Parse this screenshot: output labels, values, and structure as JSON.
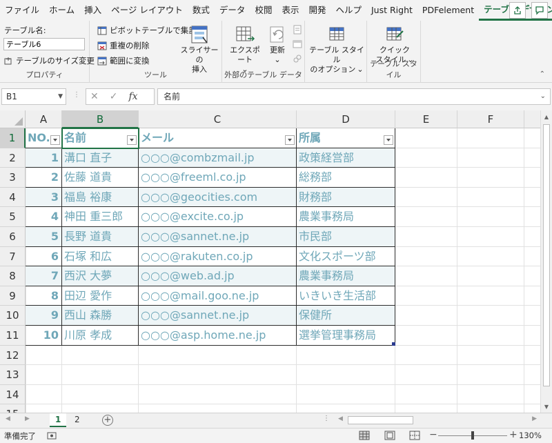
{
  "ribbon_tabs": [
    "ファイル",
    "ホーム",
    "挿入",
    "ページ レイアウト",
    "数式",
    "データ",
    "校閲",
    "表示",
    "開発",
    "ヘルプ",
    "Just Right",
    "PDFelement",
    "テーブル デザイン"
  ],
  "ribbon": {
    "properties": {
      "table_name_label": "テーブル名:",
      "table_name_value": "テーブル6",
      "resize_label": "テーブルのサイズ変更",
      "group_label": "プロパティ"
    },
    "tools": {
      "pivot_label": "ピボットテーブルで集計",
      "remove_dup_label": "重複の削除",
      "convert_label": "範囲に変換",
      "slicer_label_1": "スライサーの",
      "slicer_label_2": "挿入",
      "group_label": "ツール"
    },
    "external": {
      "export_label": "エクスポート",
      "refresh_label": "更新",
      "group_label": "外部のテーブル データ"
    },
    "style_options": {
      "label_1": "テーブル スタイル",
      "label_2": "のオプション",
      "caret": "⌄"
    },
    "styles": {
      "quick_label_1": "クイック",
      "quick_label_2": "スタイル",
      "caret": "⌄",
      "group_label": "テーブル スタイル"
    },
    "caret": "⌄"
  },
  "formula_bar": {
    "name_box": "B1",
    "cancel": "✕",
    "enter": "✓",
    "fx": "fx",
    "content": "名前"
  },
  "columns": [
    "A",
    "B",
    "C",
    "D",
    "E",
    "F"
  ],
  "rows": [
    "1",
    "2",
    "3",
    "4",
    "5",
    "6",
    "7",
    "8",
    "9",
    "10",
    "11",
    "12",
    "13",
    "14",
    "15"
  ],
  "table": {
    "headers": [
      "NO.",
      "名前",
      "メール",
      "所属"
    ],
    "rows": [
      [
        "1",
        "溝口 直子",
        "○○○@combzmail.jp",
        "政策経営部"
      ],
      [
        "2",
        "佐藤 道貴",
        "○○○@freeml.co.jp",
        "総務部"
      ],
      [
        "3",
        "福島 裕康",
        "○○○@geocities.com",
        "財務部"
      ],
      [
        "4",
        "神田 重三郎",
        "○○○@excite.co.jp",
        "農業事務局"
      ],
      [
        "5",
        "長野 道貴",
        "○○○@sannet.ne.jp",
        "市民部"
      ],
      [
        "6",
        "石塚 和広",
        "○○○@rakuten.co.jp",
        "文化スポーツ部"
      ],
      [
        "7",
        "西沢 大夢",
        "○○○@web.ad.jp",
        "農業事務局"
      ],
      [
        "8",
        "田辺 愛作",
        "○○○@mail.goo.ne.jp",
        "いきいき生活部"
      ],
      [
        "9",
        "西山 森勝",
        "○○○@sannet.ne.jp",
        "保健所"
      ],
      [
        "10",
        "川原 孝成",
        "○○○@asp.home.ne.jp",
        "選挙管理事務局"
      ]
    ]
  },
  "sheets": [
    "1",
    "2"
  ],
  "add_sheet": "+",
  "status": {
    "ready": "準備完了",
    "zoom": "130%",
    "zoom_minus": "−",
    "zoom_plus": "+"
  },
  "colors": {
    "accent": "#217346",
    "table_text": "#6fa7b8",
    "band": "#eef5f7"
  }
}
